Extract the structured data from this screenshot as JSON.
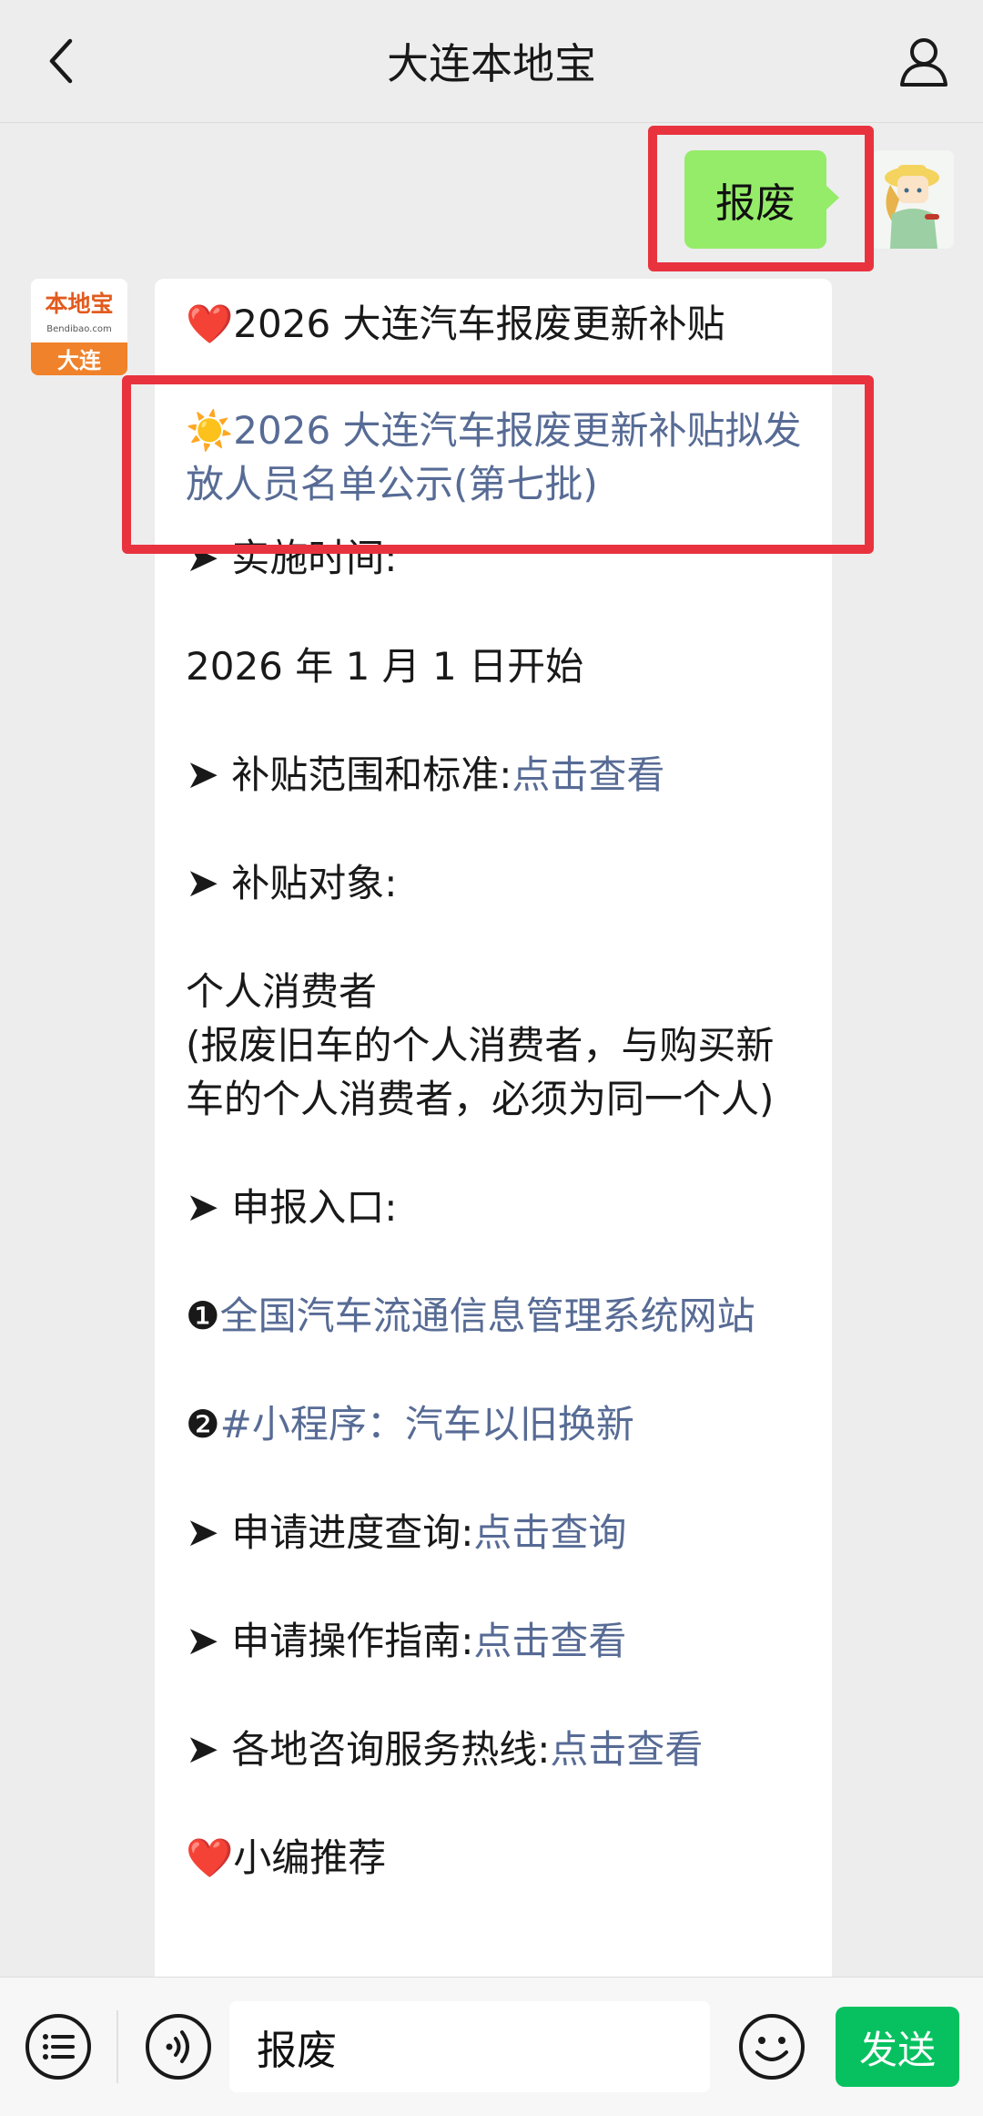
{
  "header": {
    "title": "大连本地宝",
    "back_icon": "chevron-left-icon",
    "profile_icon": "user-icon"
  },
  "user_message": {
    "text": "报废",
    "avatar_icon": "user-avatar-cartoon"
  },
  "bot_message": {
    "avatar": {
      "top_text": "本地宝",
      "sub_text": "Bendibao.com",
      "city": "大连"
    },
    "headline_icon": "❤️",
    "headline": "2026 大连汽车报废更新补贴",
    "notice_icon": "☀️",
    "notice_link": "2026 大连汽车报废更新补贴拟发放人员名单公示(第七批)",
    "arrow": "➤",
    "impl_time_label": "实施时间:",
    "impl_time_value": "2026 年 1 月 1 日开始",
    "scope_label": "补贴范围和标准:",
    "scope_link": "点击查看",
    "target_label": "补贴对象:",
    "target_value": "个人消费者",
    "target_note": "(报废旧车的个人消费者，与购买新车的个人消费者，必须为同一个人)",
    "entry_label": "申报入口:",
    "entry_1_marker": "❶",
    "entry_1_link": "全国汽车流通信息管理系统网站",
    "entry_2_marker": "❷",
    "entry_2_link": "#小程序：汽车以旧换新",
    "progress_label": "申请进度查询:",
    "progress_link": "点击查询",
    "guide_label": "申请操作指南:",
    "guide_link": "点击查看",
    "hotline_label": "各地咨询服务热线:",
    "hotline_link": "点击查看",
    "recommend_icon": "❤️",
    "recommend": "小编推荐"
  },
  "input_bar": {
    "menu_icon": "list-menu-icon",
    "voice_icon": "voice-icon",
    "input_value": "报废",
    "emoji_icon": "smile-icon",
    "send_label": "发送"
  },
  "colors": {
    "background": "#ededed",
    "user_bubble": "#95ec69",
    "link": "#576b95",
    "send_button": "#07c160",
    "highlight": "#e8333f"
  }
}
